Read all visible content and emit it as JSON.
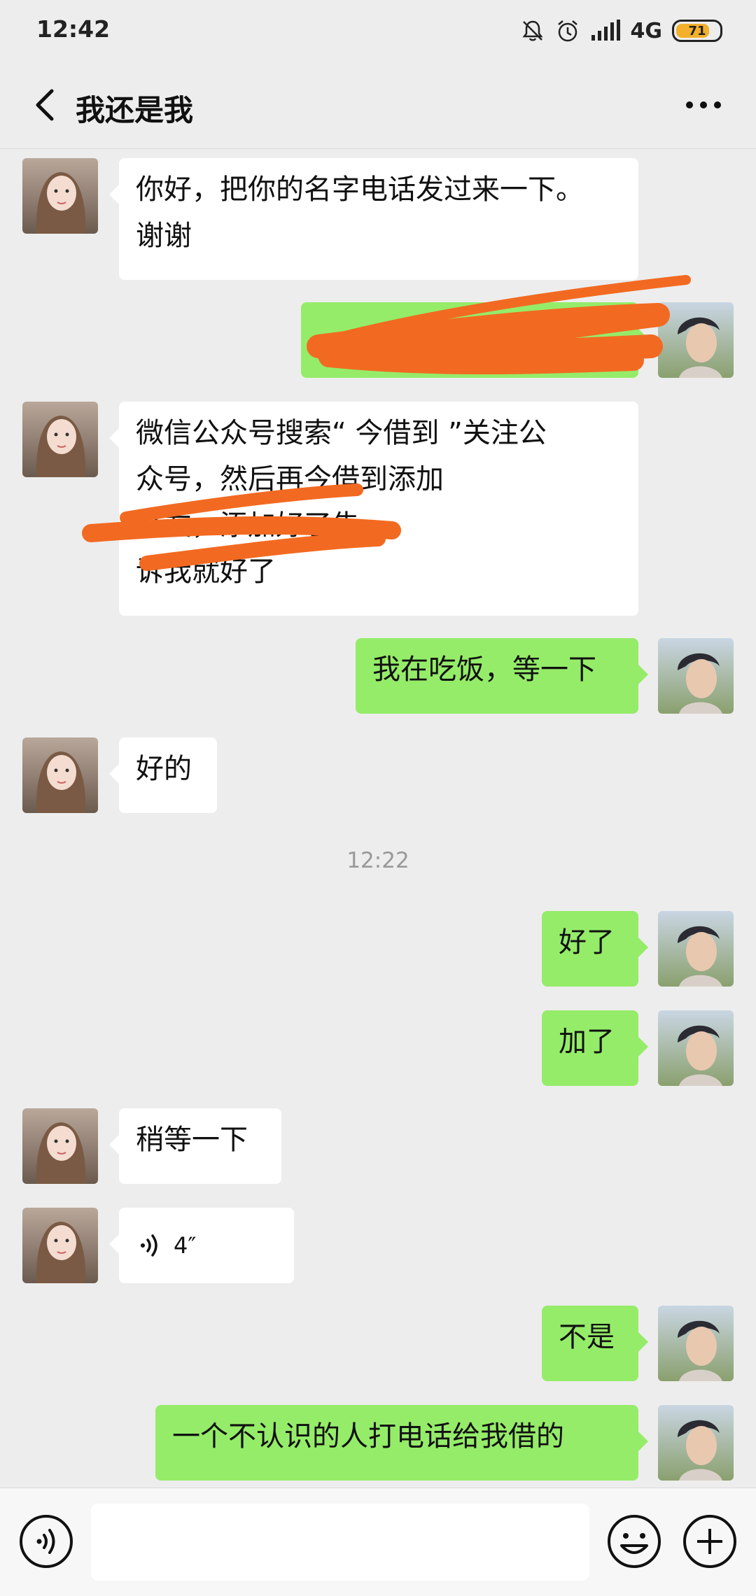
{
  "status_bar": {
    "time": "12:42",
    "network": "4G",
    "battery": "71"
  },
  "header": {
    "title": "我还是我"
  },
  "messages": [
    {
      "side": "left",
      "text": "你好，把你的名字电话发过来一下。\n谢谢"
    },
    {
      "side": "right",
      "text": ""
    },
    {
      "side": "left",
      "text": "微信公众号搜索“ 今借到 ”关注公\n众号，然后再今借到添加\n好友，添加好了告\n诉我就好了"
    },
    {
      "side": "right",
      "text": "我在吃饭，等一下"
    },
    {
      "side": "left",
      "text": "好的"
    },
    {
      "side": "right",
      "text": "好了"
    },
    {
      "side": "right",
      "text": "加了"
    },
    {
      "side": "left",
      "text": "稍等一下"
    },
    {
      "side": "left",
      "type": "voice",
      "duration": "4″"
    },
    {
      "side": "right",
      "text": "不是"
    },
    {
      "side": "right",
      "text": "一个不认识的人打电话给我借的"
    }
  ],
  "timestamp": "12:22",
  "input": {
    "value": "",
    "placeholder": ""
  },
  "colors": {
    "sent_bubble": "#95ec69",
    "received_bubble": "#ffffff",
    "background": "#ededed",
    "redaction": "#f26a21"
  },
  "icons": [
    "bell-off-icon",
    "alarm-icon",
    "signal-icon",
    "battery-icon",
    "back-icon",
    "more-icon",
    "voice-icon",
    "emoji-icon",
    "plus-icon"
  ]
}
